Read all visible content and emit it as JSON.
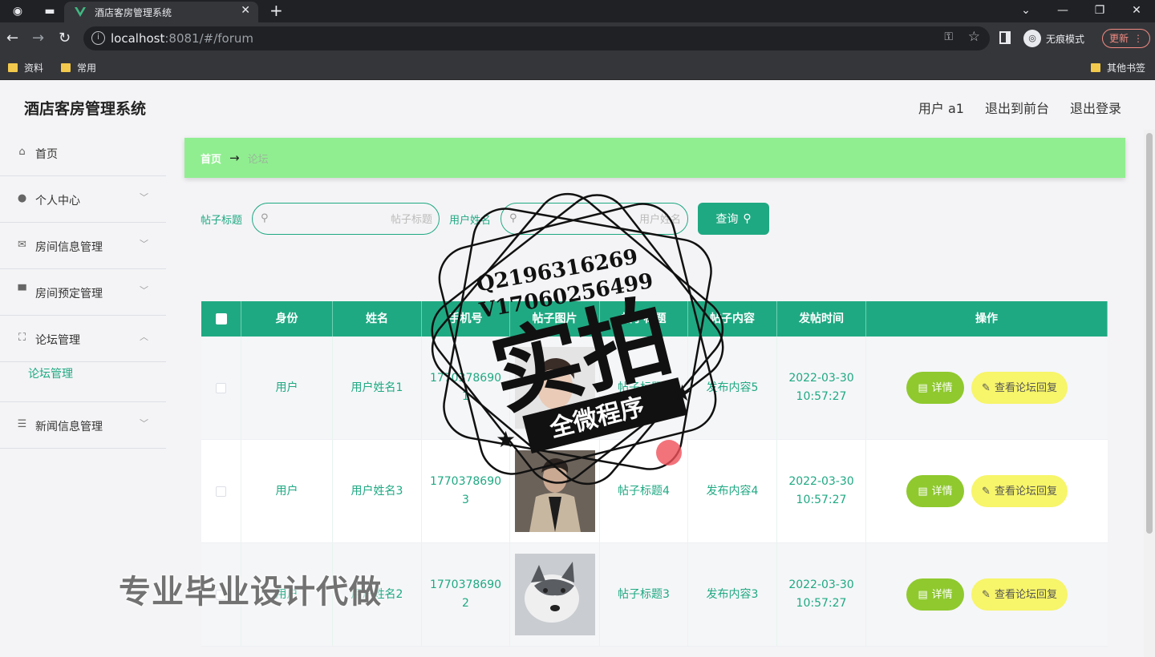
{
  "browser": {
    "tab_title": "酒店客房管理系统",
    "url_host": "localhost",
    "url_rest": ":8081/#/forum",
    "incognito_label": "无痕模式",
    "update_label": "更新",
    "bookmarks": [
      "资料",
      "常用"
    ],
    "other_bookmarks": "其他书签"
  },
  "header": {
    "brand": "酒店客房管理系统",
    "user": "用户 a1",
    "back_to_front": "退出到前台",
    "logout": "退出登录"
  },
  "sidebar": {
    "items": [
      {
        "label": "首页",
        "icon": "home-icon",
        "chevron": false
      },
      {
        "label": "个人中心",
        "icon": "user-icon",
        "chevron": true
      },
      {
        "label": "房间信息管理",
        "icon": "message-icon",
        "chevron": true
      },
      {
        "label": "房间预定管理",
        "icon": "monitor-icon",
        "chevron": true
      },
      {
        "label": "论坛管理",
        "icon": "fullscreen-icon",
        "chevron": true,
        "expanded": true
      },
      {
        "label": "新闻信息管理",
        "icon": "sliders-icon",
        "chevron": true
      }
    ],
    "sub_item": "论坛管理"
  },
  "breadcrumb": {
    "home": "首页",
    "current": "论坛"
  },
  "search": {
    "title_label": "帖子标题",
    "title_placeholder": "帖子标题",
    "name_label": "用户姓名",
    "name_placeholder": "用户姓名",
    "query_button": "查询"
  },
  "table": {
    "headers": [
      "身份",
      "姓名",
      "手机号",
      "帖子图片",
      "帖子标题",
      "帖子内容",
      "发帖时间",
      "操作"
    ],
    "rows": [
      {
        "role": "用户",
        "name": "用户姓名1",
        "phone": "17703786901",
        "title": "帖子标题5",
        "content": "发布内容5",
        "date": "2022-03-30",
        "time": "10:57:27"
      },
      {
        "role": "用户",
        "name": "用户姓名3",
        "phone": "17703786903",
        "title": "帖子标题4",
        "content": "发布内容4",
        "date": "2022-03-30",
        "time": "10:57:27"
      },
      {
        "role": "用户",
        "name": "用户姓名2",
        "phone": "17703786902",
        "title": "帖子标题3",
        "content": "发布内容3",
        "date": "2022-03-30",
        "time": "10:57:27"
      }
    ],
    "detail_button": "详情",
    "reply_button": "查看论坛回复"
  },
  "overlay": {
    "stamp_line1": "Q2196316269",
    "stamp_line2": "V17060256499",
    "stamp_main": "实拍",
    "stamp_ribbon": "全微程序",
    "bottom_watermark": "专业毕业设计代做"
  },
  "colors": {
    "primary": "#1fa982",
    "breadcrumb_bg": "#90ee90",
    "detail_btn": "#8fc92e",
    "reply_btn": "#f7f56a"
  }
}
